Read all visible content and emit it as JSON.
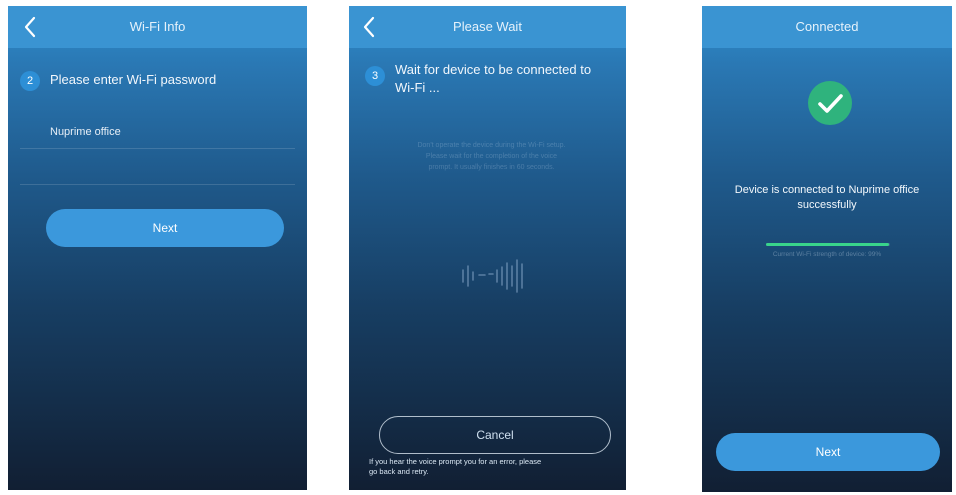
{
  "screens": {
    "wifi_info": {
      "title": "Wi-Fi Info",
      "step_number": "2",
      "step_text": "Please enter Wi-Fi password",
      "network_name": "Nuprime office",
      "next_label": "Next"
    },
    "please_wait": {
      "title": "Please Wait",
      "step_number": "3",
      "step_text_line1": "Wait for device to be connected to",
      "step_text_line2": "Wi-Fi ...",
      "hint_line1": "Don't operate the device during the Wi-Fi setup.",
      "hint_line2": "Please wait for the completion of the voice",
      "hint_line3": "prompt. It usually finishes in 60 seconds.",
      "cancel_label": "Cancel",
      "footer_line1": "If you hear the voice prompt you for an error, please",
      "footer_line2": "go back and retry."
    },
    "connected": {
      "title": "Connected",
      "message_line1": "Device is connected to Nuprime office",
      "message_line2": "successfully",
      "strength_text": "Current Wi-Fi strength of device: 99%",
      "strength_value": 0.99,
      "next_label": "Next"
    }
  },
  "icons": {
    "back": "chevron-left-icon",
    "check": "checkmark-icon",
    "sound": "sound-wave-icon"
  },
  "colors": {
    "header": "#3a94d2",
    "button": "#3b98dc",
    "success": "#2fb37d",
    "strength": "#39d48b"
  }
}
